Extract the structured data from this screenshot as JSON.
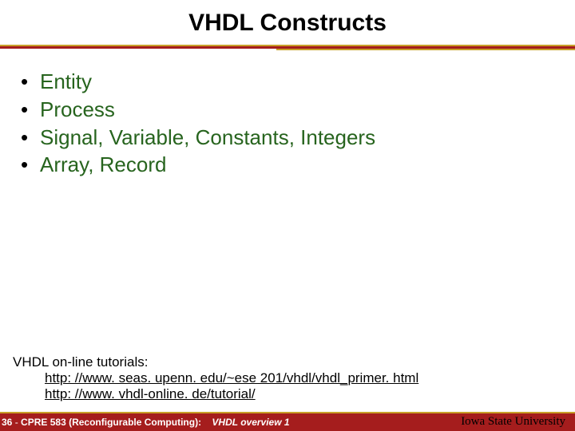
{
  "title": "VHDL Constructs",
  "bullets": [
    "Entity",
    "Process",
    "Signal, Variable, Constants, Integers",
    "Array, Record"
  ],
  "tutorials": {
    "heading": "VHDL on-line tutorials:",
    "links": [
      "http: //www. seas. upenn. edu/~ese 201/vhdl/vhdl_primer. html",
      "http: //www. vhdl-online. de/tutorial/"
    ]
  },
  "footer": {
    "page_number": "36",
    "course": "CPRE 583 (Reconfigurable Computing):",
    "subtitle": "VHDL overview 1",
    "institution": "Iowa State University"
  }
}
